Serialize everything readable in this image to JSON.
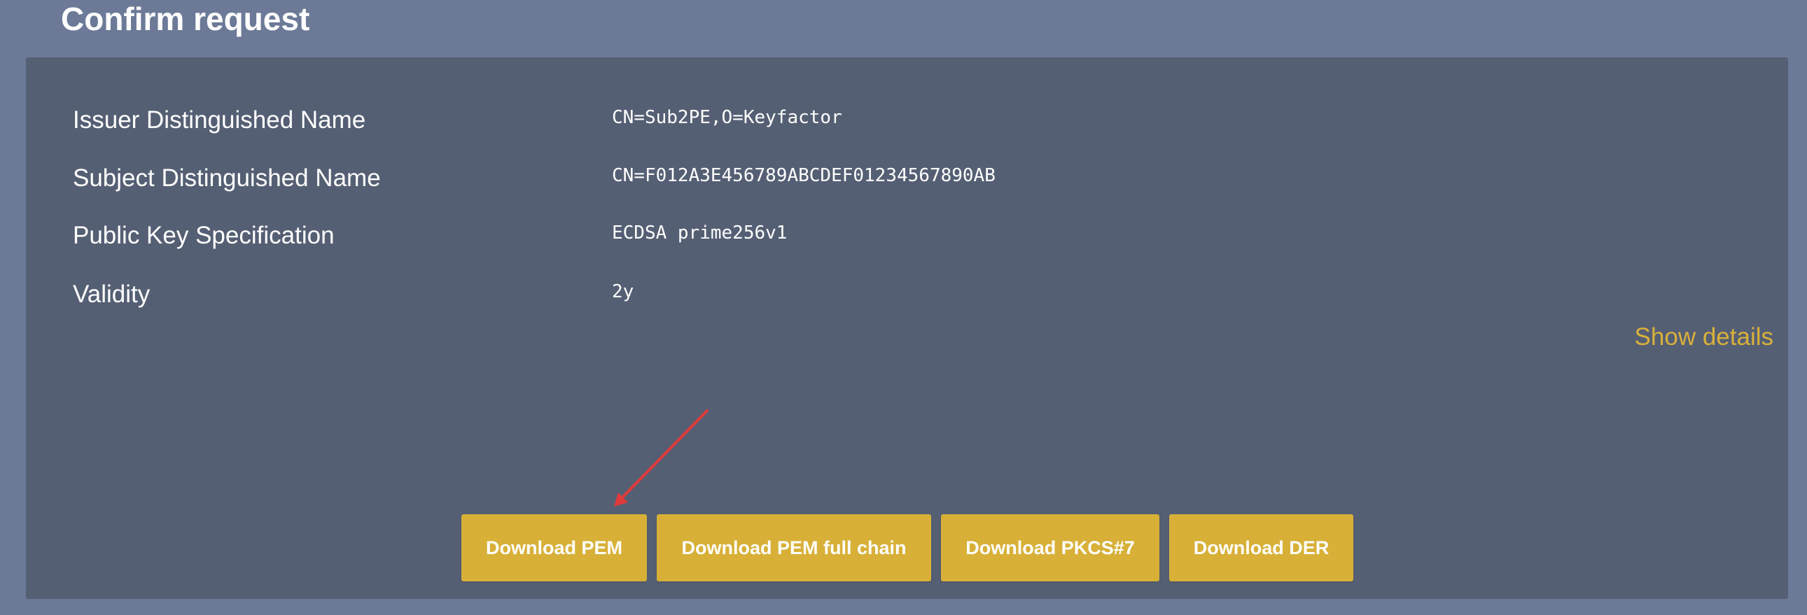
{
  "page": {
    "title": "Confirm request"
  },
  "details": [
    {
      "label": "Issuer Distinguished Name",
      "value": "CN=Sub2PE,O=Keyfactor"
    },
    {
      "label": "Subject Distinguished Name",
      "value": "CN=F012A3E456789ABCDEF01234567890AB"
    },
    {
      "label": "Public Key Specification",
      "value": "ECDSA prime256v1"
    },
    {
      "label": "Validity",
      "value": "2y"
    }
  ],
  "show_details_label": "Show details",
  "buttons": {
    "download_pem": "Download PEM",
    "download_pem_full_chain": "Download PEM full chain",
    "download_pkcs7": "Download PKCS#7",
    "download_der": "Download DER"
  },
  "colors": {
    "background": "#6c7a98",
    "panel": "#555f74",
    "accent": "#d8b038",
    "link": "#d9b13a",
    "annotation_arrow": "#e03a3a"
  }
}
